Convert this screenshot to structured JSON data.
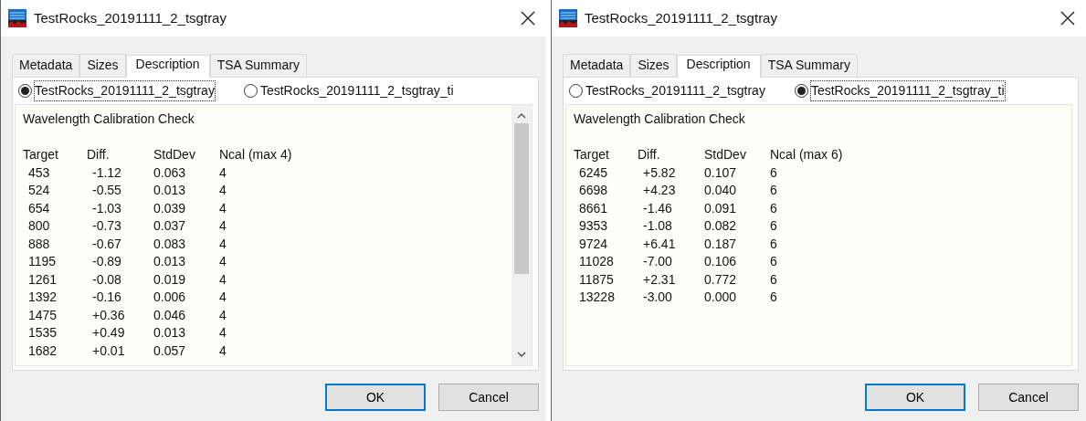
{
  "dialogs": [
    {
      "title": "TestRocks_20191111_2_tsgtray",
      "scrollbar": true,
      "tabs": [
        {
          "label": "Metadata",
          "selected": false
        },
        {
          "label": "Sizes",
          "selected": false
        },
        {
          "label": "Description",
          "selected": true
        },
        {
          "label": "TSA Summary",
          "selected": false
        }
      ],
      "radios": [
        {
          "label": "TestRocks_20191111_2_tsgtray",
          "selected": true
        },
        {
          "label": "TestRocks_20191111_2_tsgtray_ti",
          "selected": false
        }
      ],
      "heading": "Wavelength Calibration Check",
      "columns": [
        "Target",
        "Diff.",
        "StdDev",
        "Ncal (max 4)"
      ],
      "rows": [
        [
          "453",
          "-1.12",
          "0.063",
          "4"
        ],
        [
          "524",
          "-0.55",
          "0.013",
          "4"
        ],
        [
          "654",
          "-1.03",
          "0.039",
          "4"
        ],
        [
          "800",
          "-0.73",
          "0.037",
          "4"
        ],
        [
          "888",
          "-0.67",
          "0.083",
          "4"
        ],
        [
          "1195",
          "-0.89",
          "0.013",
          "4"
        ],
        [
          "1261",
          "-0.08",
          "0.019",
          "4"
        ],
        [
          "1392",
          "-0.16",
          "0.006",
          "4"
        ],
        [
          "1475",
          "+0.36",
          "0.046",
          "4"
        ],
        [
          "1535",
          "+0.49",
          "0.013",
          "4"
        ],
        [
          "1682",
          "+0.01",
          "0.057",
          "4"
        ]
      ],
      "buttons": [
        {
          "label": "OK",
          "default": true
        },
        {
          "label": "Cancel",
          "default": false
        }
      ]
    },
    {
      "title": "TestRocks_20191111_2_tsgtray",
      "scrollbar": false,
      "tabs": [
        {
          "label": "Metadata",
          "selected": false
        },
        {
          "label": "Sizes",
          "selected": false
        },
        {
          "label": "Description",
          "selected": true
        },
        {
          "label": "TSA Summary",
          "selected": false
        }
      ],
      "radios": [
        {
          "label": "TestRocks_20191111_2_tsgtray",
          "selected": false
        },
        {
          "label": "TestRocks_20191111_2_tsgtray_ti",
          "selected": true
        }
      ],
      "heading": "Wavelength Calibration Check",
      "columns": [
        "Target",
        "Diff.",
        "StdDev",
        "Ncal (max 6)"
      ],
      "rows": [
        [
          "6245",
          "+5.82",
          "0.107",
          "6"
        ],
        [
          "6698",
          "+4.23",
          "0.040",
          "6"
        ],
        [
          "8661",
          "-1.46",
          "0.091",
          "6"
        ],
        [
          "9353",
          "-1.08",
          "0.082",
          "6"
        ],
        [
          "9724",
          "+6.41",
          "0.187",
          "6"
        ],
        [
          "11028",
          "-7.00",
          "0.106",
          "6"
        ],
        [
          "11875",
          "+2.31",
          "0.772",
          "6"
        ],
        [
          "13228",
          "-3.00",
          "0.000",
          "6"
        ]
      ],
      "buttons": [
        {
          "label": "OK",
          "default": true
        },
        {
          "label": "Cancel",
          "default": false
        }
      ]
    }
  ]
}
